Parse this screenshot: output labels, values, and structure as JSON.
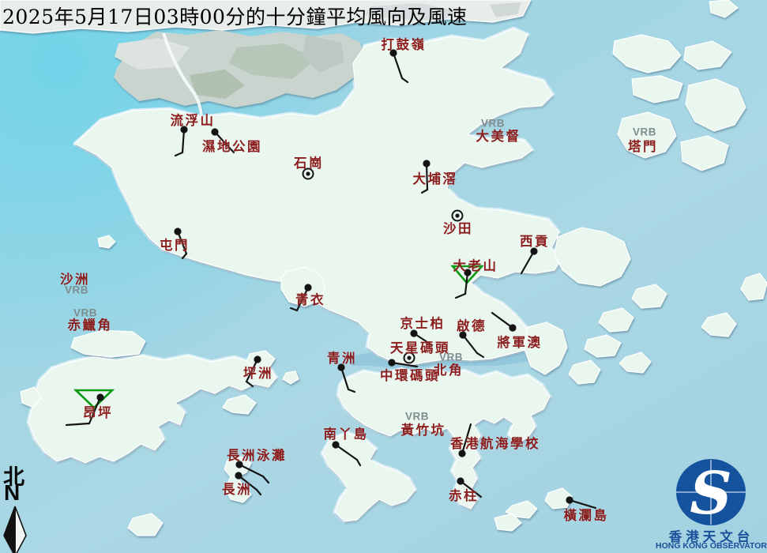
{
  "title": "2025年5月17日03時00分的十分鐘平均風向及風速",
  "compass": {
    "chinese": "北",
    "letter": "N"
  },
  "logo": {
    "monogram": "S",
    "chinese": "香港天文台",
    "english": "HONG KONG OBSERVATORY"
  },
  "legend": {
    "vrb_text": "VRB"
  },
  "colors": {
    "sea": "#9fd5e4",
    "deep_bay": "#6ed4ea",
    "land": "#eaf7ef",
    "shenzhen": "#c9d4cf",
    "station_label": "#8b1d1d",
    "vrb_gray": "#7f8c90",
    "barb": "#141414",
    "triangle_green": "#0a9a14",
    "logo_blue": "#15539e",
    "logo_text": "#1a4f9b"
  },
  "stations": [
    {
      "name": "打鼓嶺",
      "type": "barb",
      "label": [
        511,
        55
      ],
      "dot": [
        498,
        67
      ],
      "staff": [
        509,
        99
      ],
      "feather": [
        516,
        104
      ]
    },
    {
      "name": "流浮山",
      "type": "barb",
      "label": [
        244,
        151
      ],
      "dot": [
        233,
        164
      ],
      "staff": [
        231,
        193
      ],
      "feather": [
        222,
        197
      ]
    },
    {
      "name": "濕地公園",
      "type": "barb",
      "label": [
        294,
        184
      ],
      "dot": [
        272,
        167
      ],
      "staff": [
        296,
        193
      ],
      "feather": null
    },
    {
      "name": "石崗",
      "type": "calm",
      "label": [
        391,
        205
      ],
      "dot": [
        390,
        220
      ]
    },
    {
      "name": "大埔滘",
      "type": "barb",
      "label": [
        551,
        225
      ],
      "dot": [
        540,
        207
      ],
      "staff": [
        541,
        240
      ],
      "feather": [
        534,
        244
      ]
    },
    {
      "name": "大美督",
      "type": "vrb",
      "label": [
        631,
        171
      ],
      "vrb": [
        624,
        156
      ]
    },
    {
      "name": "塔門",
      "type": "vrb",
      "label": [
        814,
        184
      ],
      "vrb": [
        816,
        167
      ]
    },
    {
      "name": "沙田",
      "type": "calm",
      "label": [
        580,
        288
      ],
      "dot": [
        579,
        273
      ]
    },
    {
      "name": "西貢",
      "type": "barb",
      "label": [
        677,
        304
      ],
      "dot": [
        676,
        318
      ],
      "staff": [
        660,
        346
      ],
      "feather": null
    },
    {
      "name": "大老山",
      "type": "barb",
      "label": [
        602,
        335
      ],
      "dot": [
        592,
        345
      ],
      "staff": [
        589,
        372
      ],
      "feather": [
        577,
        377
      ],
      "triangle": [
        [
          573,
          337
        ],
        [
          610,
          337
        ],
        [
          591,
          358
        ]
      ]
    },
    {
      "name": "屯門",
      "type": "barb",
      "label": [
        221,
        309
      ],
      "dot": [
        225,
        293
      ],
      "staff": [
        236,
        321
      ],
      "feather": [
        231,
        327
      ]
    },
    {
      "name": "沙洲",
      "type": "vrb",
      "label": [
        95,
        352
      ],
      "vrb": [
        97,
        367
      ]
    },
    {
      "name": "赤鱲角",
      "type": "vrb",
      "label": [
        114,
        410
      ],
      "vrb": [
        108,
        396
      ]
    },
    {
      "name": "青衣",
      "type": "barb",
      "label": [
        393,
        378
      ],
      "dot": [
        390,
        364
      ],
      "staff": [
        376,
        393
      ],
      "feather": [
        368,
        390
      ]
    },
    {
      "name": "京士柏",
      "type": "barb",
      "label": [
        535,
        408
      ],
      "dot": [
        524,
        422
      ],
      "staff": [
        547,
        437
      ],
      "feather": null
    },
    {
      "name": "天星碼頭",
      "type": "calm",
      "label": [
        532,
        439
      ],
      "dot": [
        518,
        453
      ]
    },
    {
      "name": "中環碼頭",
      "type": "barb",
      "label": [
        519,
        474
      ],
      "dot": [
        496,
        459
      ],
      "staff": [
        528,
        464
      ],
      "feather": null
    },
    {
      "name": "北角",
      "type": "vrb",
      "label": [
        568,
        467
      ],
      "vrb": [
        571,
        452
      ]
    },
    {
      "name": "啟德",
      "type": "barb",
      "label": [
        597,
        411
      ],
      "dot": [
        586,
        424
      ],
      "staff": [
        604,
        447
      ],
      "feather": [
        612,
        452
      ]
    },
    {
      "name": "將軍澳",
      "type": "barb",
      "label": [
        658,
        432
      ],
      "dot": [
        649,
        415
      ],
      "staff": [
        623,
        396
      ],
      "feather": null
    },
    {
      "name": "坪洲",
      "type": "barb",
      "label": [
        327,
        471
      ],
      "dot": [
        326,
        455
      ],
      "staff": [
        312,
        483
      ],
      "feather": [
        320,
        489
      ]
    },
    {
      "name": "青洲",
      "type": "barb",
      "label": [
        433,
        452
      ],
      "dot": [
        432,
        465
      ],
      "staff": [
        441,
        493
      ],
      "feather": [
        449,
        496
      ]
    },
    {
      "name": "昂坪",
      "type": "barb",
      "label": [
        124,
        521
      ],
      "dot": [
        127,
        503
      ],
      "staff": [
        113,
        536
      ],
      "feather": [
        84,
        538
      ],
      "triangle": [
        [
          96,
          494
        ],
        [
          142,
          494
        ],
        [
          119,
          516
        ]
      ]
    },
    {
      "name": "南丫島",
      "type": "barb",
      "label": [
        438,
        548
      ],
      "dot": [
        425,
        563
      ],
      "staff": [
        452,
        582
      ],
      "feather": [
        456,
        589
      ]
    },
    {
      "name": "長洲泳灘",
      "type": "barb",
      "label": [
        325,
        575
      ],
      "dot": [
        303,
        588
      ],
      "staff": [
        333,
        603
      ],
      "feather": [
        340,
        611
      ]
    },
    {
      "name": "長洲",
      "type": "barb",
      "label": [
        300,
        618
      ],
      "dot": [
        302,
        602
      ],
      "staff": [
        325,
        620
      ],
      "feather": [
        330,
        626
      ]
    },
    {
      "name": "黃竹坑",
      "type": "vrb",
      "label": [
        536,
        543
      ],
      "vrb": [
        528,
        527
      ]
    },
    {
      "name": "香港航海學校",
      "type": "barb",
      "label": [
        627,
        560
      ],
      "dot": [
        585,
        574
      ],
      "staff": [
        596,
        537
      ],
      "feather": null
    },
    {
      "name": "赤柱",
      "type": "barb",
      "label": [
        587,
        626
      ],
      "dot": [
        583,
        609
      ],
      "staff": [
        609,
        629
      ],
      "feather": null
    },
    {
      "name": "橫瀾島",
      "type": "barb",
      "label": [
        742,
        651
      ],
      "dot": [
        721,
        633
      ],
      "staff": [
        754,
        643
      ],
      "feather": null
    }
  ]
}
